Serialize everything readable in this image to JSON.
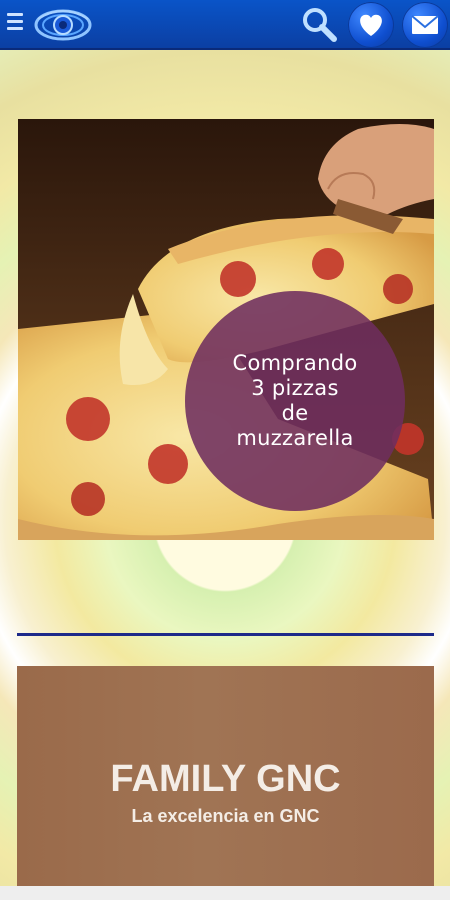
{
  "header": {
    "menu_icon": "hamburger-menu-icon",
    "logo_icon": "eye-logo-icon",
    "search_icon": "search-icon",
    "favorites_icon": "heart-icon",
    "mail_icon": "envelope-icon",
    "accent_color": "#0b4cc0"
  },
  "promo": {
    "image": "pizza-slice-photo",
    "text": "Comprando\n3 pizzas\nde\nmuzzarella",
    "circle_color": "#6e2d5f"
  },
  "brand": {
    "title": "FAMILY GNC",
    "subtitle": "La excelencia en GNC",
    "background_color": "#a07454"
  }
}
